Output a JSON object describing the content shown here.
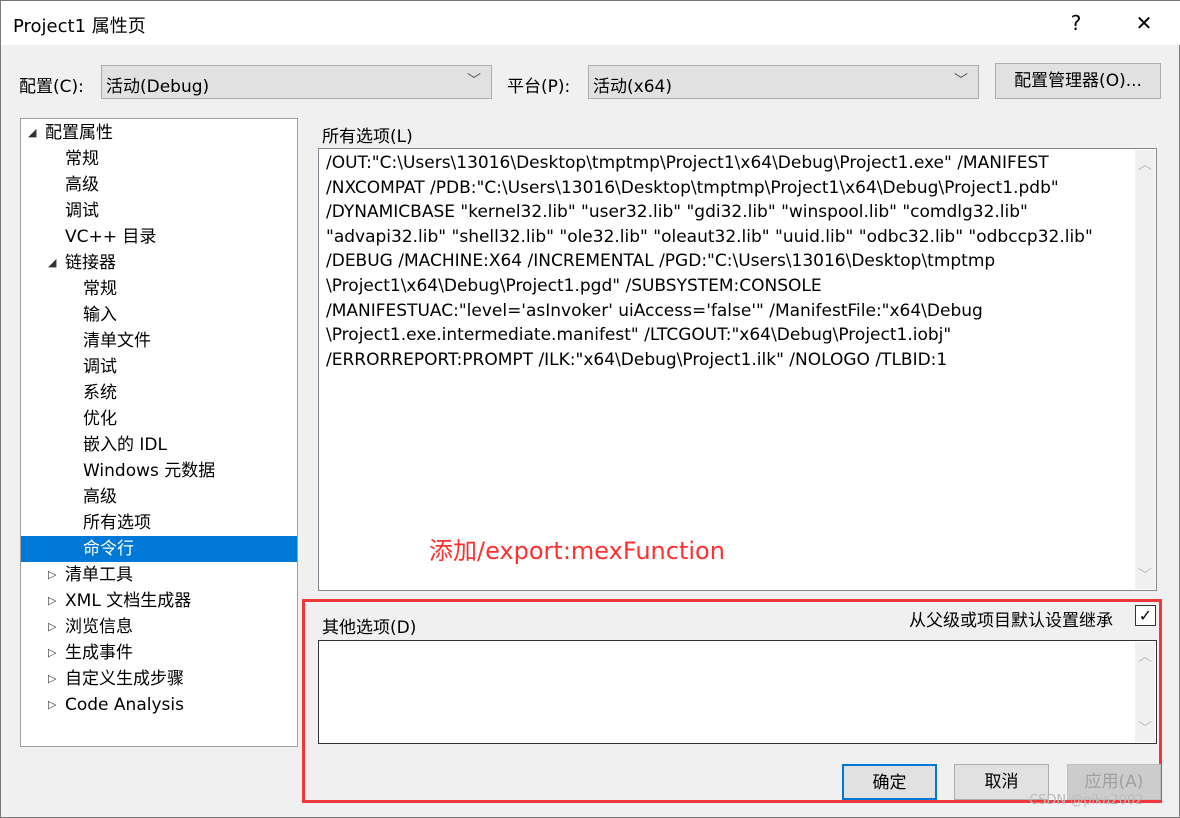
{
  "window": {
    "title": "Project1 属性页",
    "help": "?",
    "close": "✕"
  },
  "config": {
    "label": "配置(C):",
    "value": "活动(Debug)"
  },
  "platform": {
    "label": "平台(P):",
    "value": "活动(x64)"
  },
  "config_manager": "配置管理器(O)...",
  "tree": [
    {
      "label": "配置属性",
      "level": 0,
      "expanded": true
    },
    {
      "label": "常规",
      "level": 1
    },
    {
      "label": "高级",
      "level": 1
    },
    {
      "label": "调试",
      "level": 1
    },
    {
      "label": "VC++ 目录",
      "level": 1
    },
    {
      "label": "链接器",
      "level": 1,
      "expanded": true
    },
    {
      "label": "常规",
      "level": 2
    },
    {
      "label": "输入",
      "level": 2
    },
    {
      "label": "清单文件",
      "level": 2
    },
    {
      "label": "调试",
      "level": 2
    },
    {
      "label": "系统",
      "level": 2
    },
    {
      "label": "优化",
      "level": 2
    },
    {
      "label": "嵌入的 IDL",
      "level": 2
    },
    {
      "label": "Windows 元数据",
      "level": 2
    },
    {
      "label": "高级",
      "level": 2
    },
    {
      "label": "所有选项",
      "level": 2
    },
    {
      "label": "命令行",
      "level": 2,
      "selected": true
    },
    {
      "label": "清单工具",
      "level": 1,
      "expanded": false
    },
    {
      "label": "XML 文档生成器",
      "level": 1,
      "expanded": false
    },
    {
      "label": "浏览信息",
      "level": 1,
      "expanded": false
    },
    {
      "label": "生成事件",
      "level": 1,
      "expanded": false
    },
    {
      "label": "自定义生成步骤",
      "level": 1,
      "expanded": false
    },
    {
      "label": "Code Analysis",
      "level": 1,
      "expanded": false
    }
  ],
  "all_options": {
    "label": "所有选项(L)",
    "text": "/OUT:\"C:\\Users\\13016\\Desktop\\tmptmp\\Project1\\x64\\Debug\\Project1.exe\" /MANIFEST\n/NXCOMPAT /PDB:\"C:\\Users\\13016\\Desktop\\tmptmp\\Project1\\x64\\Debug\\Project1.pdb\"\n/DYNAMICBASE \"kernel32.lib\" \"user32.lib\" \"gdi32.lib\" \"winspool.lib\" \"comdlg32.lib\"\n\"advapi32.lib\" \"shell32.lib\" \"ole32.lib\" \"oleaut32.lib\" \"uuid.lib\" \"odbc32.lib\" \"odbccp32.lib\"\n/DEBUG /MACHINE:X64 /INCREMENTAL /PGD:\"C:\\Users\\13016\\Desktop\\tmptmp\n\\Project1\\x64\\Debug\\Project1.pgd\" /SUBSYSTEM:CONSOLE\n/MANIFESTUAC:\"level='asInvoker' uiAccess='false'\" /ManifestFile:\"x64\\Debug\n\\Project1.exe.intermediate.manifest\" /LTCGOUT:\"x64\\Debug\\Project1.iobj\"\n/ERRORREPORT:PROMPT /ILK:\"x64\\Debug\\Project1.ilk\" /NOLOGO /TLBID:1"
  },
  "annotation": "添加/export:mexFunction",
  "other_options": {
    "label": "其他选项(D)",
    "value": "",
    "inherit_label": "从父级或项目默认设置继承",
    "inherit_checked": true
  },
  "buttons": {
    "ok": "确定",
    "cancel": "取消",
    "apply": "应用(A)"
  },
  "watermark": "CSDN @pika2002",
  "colors": {
    "selection": "#0078d7",
    "annotation": "#f0373a"
  }
}
